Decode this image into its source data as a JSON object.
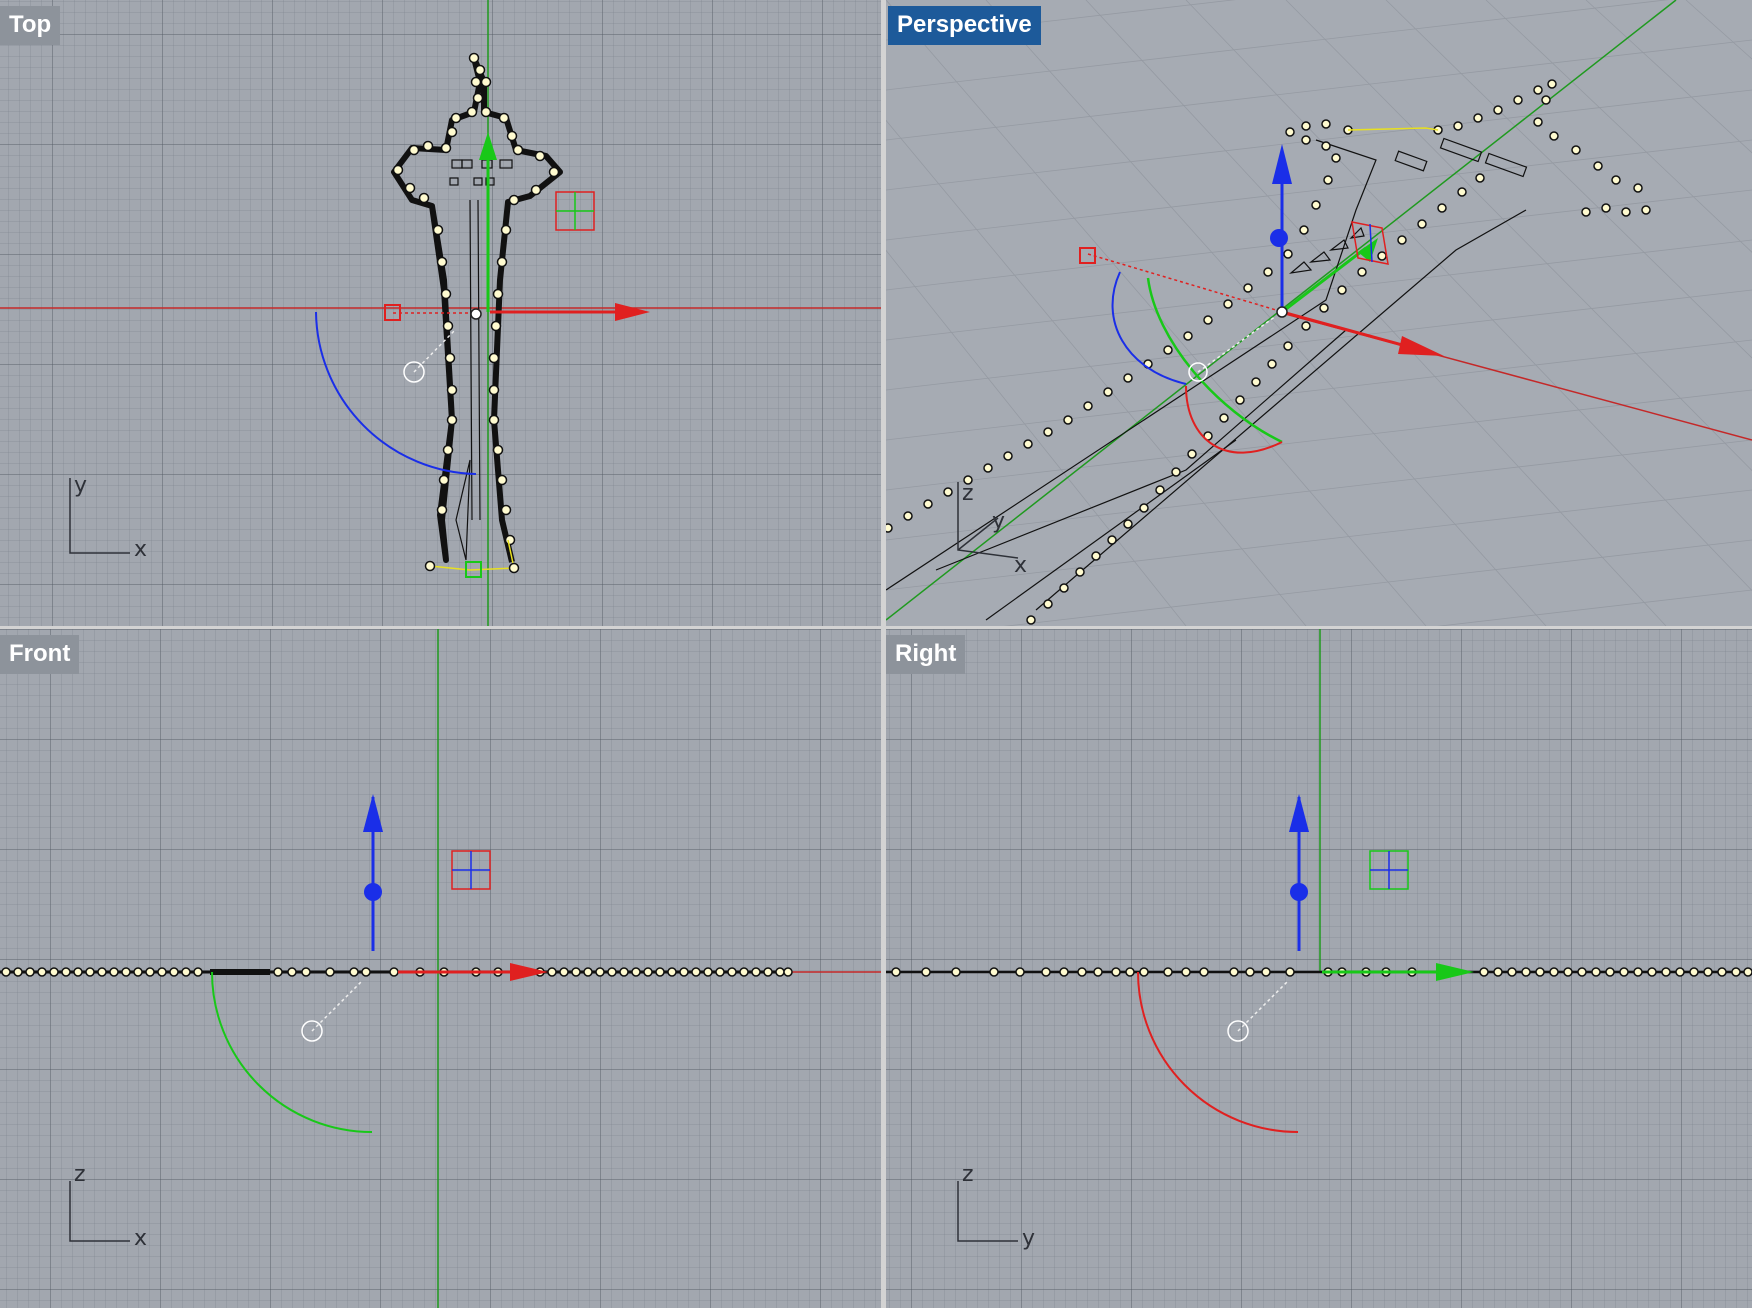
{
  "viewports": {
    "top": {
      "title": "Top",
      "axis_a": "y",
      "axis_b": "x"
    },
    "perspective": {
      "title": "Perspective",
      "axis_a": "z",
      "axis_b": "y",
      "axis_c": "x"
    },
    "front": {
      "title": "Front",
      "axis_a": "z",
      "axis_b": "x"
    },
    "right": {
      "title": "Right",
      "axis_a": "z",
      "axis_b": "y"
    }
  },
  "colors": {
    "x_axis": "#e02020",
    "y_axis": "#18c818",
    "z_axis": "#1a2ee8",
    "point_fill": "#fffbd0",
    "active_title": "#1d5a9a"
  }
}
